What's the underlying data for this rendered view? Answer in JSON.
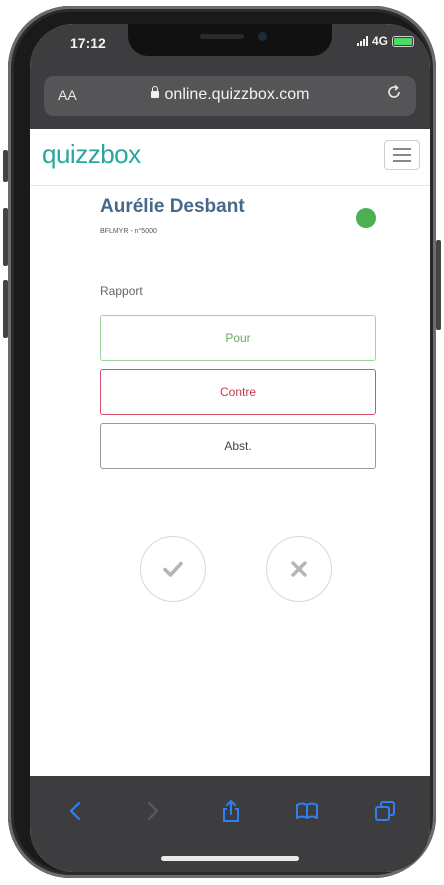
{
  "status": {
    "time": "17:12",
    "network": "4G"
  },
  "browser": {
    "text_size_label": "AA",
    "url": "online.quizzbox.com"
  },
  "site": {
    "logo": "quizzbox"
  },
  "participant": {
    "name": "Aurélie Desbant",
    "id_line": "BFLMYR - n°5000",
    "status_color": "#4caf50"
  },
  "question": {
    "label": "Rapport"
  },
  "options": {
    "pour": "Pour",
    "contre": "Contre",
    "abst": "Abst."
  },
  "colors": {
    "brand": "#2aa79b",
    "name": "#46698a",
    "pour": "#9ed59b",
    "contre": "#d9526d",
    "toolbar_icon": "#2f7ff0"
  },
  "icons": {
    "confirm": "check-icon",
    "cancel": "x-icon"
  }
}
